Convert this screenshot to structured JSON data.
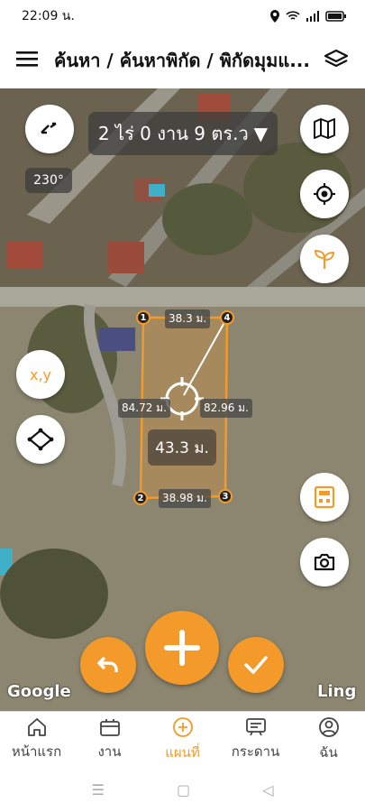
{
  "status": {
    "time": "22:09 น."
  },
  "header": {
    "menu_icon": "hamburger-icon",
    "title": "ค้นหา / ค้นหาพิกัด / พิกัดมุมแ...",
    "layers_icon": "layers-icon"
  },
  "map": {
    "area_text": "2 ไร่ 0 งาน 9 ตร.ว",
    "rotation": "230°",
    "xy_label": "x,y",
    "measurements": {
      "top": "38.3 ม.",
      "bottom": "38.98 ม.",
      "left": "84.72 ม.",
      "right": "82.96 ม.",
      "center": "43.3 ม."
    },
    "vertices": [
      "1",
      "2",
      "3",
      "4"
    ],
    "attribution_left": "Google",
    "attribution_right": "Ling",
    "accent": "#f39a2a"
  },
  "nav": [
    {
      "label": "หน้าแรก",
      "icon": "home-icon"
    },
    {
      "label": "งาน",
      "icon": "briefcase-icon"
    },
    {
      "label": "แผนที่",
      "icon": "add-circle-icon"
    },
    {
      "label": "กระดาน",
      "icon": "board-icon"
    },
    {
      "label": "ฉัน",
      "icon": "user-icon"
    }
  ]
}
